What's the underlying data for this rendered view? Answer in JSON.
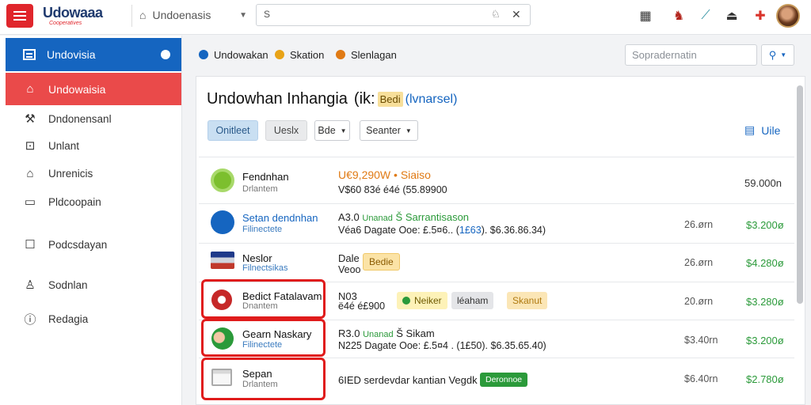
{
  "header": {
    "logo": "Udowaaa",
    "logo_sub": "Cooperatives",
    "workspace": "Undoenasis",
    "search_placeholder": "S",
    "search_icon": "search-icon",
    "icons": [
      "clipboard-icon",
      "mask-icon",
      "magic-wand-icon",
      "eject-icon",
      "plus-cross-icon"
    ]
  },
  "sidebar": {
    "head_label": "Undovisia",
    "active_label": "Undowaisia",
    "items": [
      {
        "label": "Dndonensanl",
        "icon": "tools-icon"
      },
      {
        "label": "Unlant",
        "icon": "camera-icon"
      },
      {
        "label": "Unrenicis",
        "icon": "home-icon"
      },
      {
        "label": "Pldcoopain",
        "icon": "document-icon"
      },
      {
        "label": "Podcsdayan",
        "icon": "square-icon"
      },
      {
        "label": "Sodnlan",
        "icon": "user-icon"
      },
      {
        "label": "Redagia",
        "icon": "info-icon"
      }
    ]
  },
  "toolbar": {
    "pills": [
      {
        "label": "Undowakan",
        "color": "#1565c0"
      },
      {
        "label": "Skation",
        "color": "#e8a317"
      },
      {
        "label": "Slenlagan",
        "color": "#e07a14"
      }
    ],
    "filter_placeholder": "Sopradernatin"
  },
  "panel": {
    "title_main": "Undowhan Inhangia",
    "title_paren_open": "(ik:",
    "title_badge": "Bedi",
    "title_link": "(lvnarsel)",
    "btn_primary": "Onitleet",
    "btn_secondary": "Ueslx",
    "drop1": "Bde",
    "drop2": "Seanter",
    "view_link": "Uile"
  },
  "rows": [
    {
      "name": "Fendnhan",
      "sub": "Drlantem",
      "line1": "U€9,290W • Siaiso",
      "line2": "V$60 83é é4é (55.89900",
      "qty": "",
      "amount": "59.000n"
    },
    {
      "name": "Setan dendnhan",
      "sub": "Filinectete",
      "line1_a": "A3.0",
      "line1_b": "Unanad",
      "line1_c": "Š Sarrantisason",
      "line2_a": "Véa6 Dagate Ooe: £.5¤6.. (",
      "line2_b": "1£63",
      "line2_c": "). $6.36.86.34)",
      "qty": "26.ørn",
      "amount": "$3.200ø"
    },
    {
      "name": "Neslor",
      "sub": "Filnectsikas",
      "line1": "Dale",
      "line2": "Veoo",
      "tag": "Bedie",
      "qty": "26.ørn",
      "amount": "$4.280ø"
    },
    {
      "name": "Bedict Fatalavam",
      "sub": "Dnantem",
      "line1": "N03",
      "line2": "ë4é é£900",
      "tag1": "Neiker",
      "tag2": "léaham",
      "tag3": "Skanut",
      "qty": "20.ørn",
      "amount": "$3.280ø"
    },
    {
      "name": "Gearn Naskary",
      "sub": "Filinectete",
      "line1_a": "R3.0",
      "line1_b": "Unanad",
      "line1_c": "Š Sikam",
      "line2": "N225 Dagate Ooe: £.5¤4 . (1£50). $6.35.65.40)",
      "qty": "$3.40rn",
      "amount": "$3.200ø"
    },
    {
      "name": "Sepan",
      "sub": "Drlantem",
      "line1": "6IED serdevdar kantian Vegdk",
      "tag": "Deronnoe",
      "qty": "$6.40rn",
      "amount": "$2.780ø"
    }
  ]
}
